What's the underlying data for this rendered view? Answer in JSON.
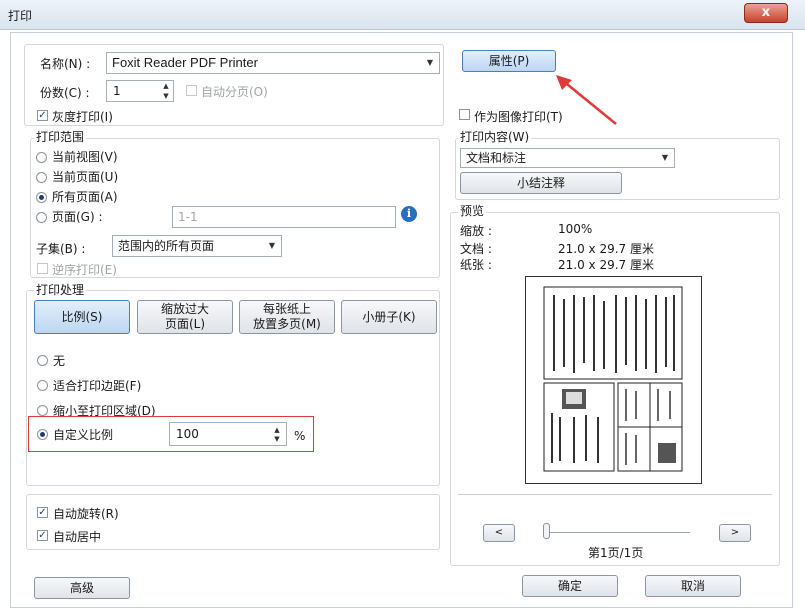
{
  "window": {
    "title": "打印",
    "close_label": "x"
  },
  "printer": {
    "name_label": "名称(N) :",
    "name_value": "Foxit Reader PDF Printer",
    "properties_button": "属性(P)",
    "copies_label": "份数(C) :",
    "copies_value": "1",
    "collate_label": "自动分页(O)",
    "grayscale_label": "灰度打印(I)",
    "as_image_label": "作为图像打印(T)"
  },
  "print_range": {
    "title": "打印范围",
    "options": [
      "当前视图(V)",
      "当前页面(U)",
      "所有页面(A)",
      "页面(G) :"
    ],
    "pages_placeholder": "1-1",
    "subset_label": "子集(B) :",
    "subset_value": "范围内的所有页面",
    "reverse_label": "逆序打印(E)"
  },
  "print_content": {
    "title": "打印内容(W)",
    "content_value": "文档和标注",
    "summarize_button": "小结注释"
  },
  "preview": {
    "title": "预览",
    "zoom_label": "缩放 :",
    "zoom_value": "100%",
    "doc_label": "文档 :",
    "doc_value": "21.0 x 29.7 厘米",
    "paper_label": "纸张 :",
    "paper_value": "21.0 x 29.7 厘米",
    "prev_label": "<",
    "next_label": ">",
    "page_indicator": "第1页/1页"
  },
  "handling": {
    "title": "打印处理",
    "btn_scale": "比例(S)",
    "btn_shrink": [
      "缩放过大",
      "页面(L)"
    ],
    "btn_multi": [
      "每张纸上",
      "放置多页(M)"
    ],
    "btn_booklet": "小册子(K)",
    "options": [
      "无",
      "适合打印边距(F)",
      "缩小至打印区域(D)",
      "自定义比例"
    ],
    "custom_value": "100",
    "percent": "%"
  },
  "auto": {
    "rotate_label": "自动旋转(R)",
    "center_label": "自动居中"
  },
  "footer": {
    "advanced": "高级",
    "ok": "确定",
    "cancel": "取消"
  },
  "colors": {
    "highlight": "#e03a3a",
    "arrow": "#e03a3a",
    "info_icon": "#2a6ec4"
  }
}
